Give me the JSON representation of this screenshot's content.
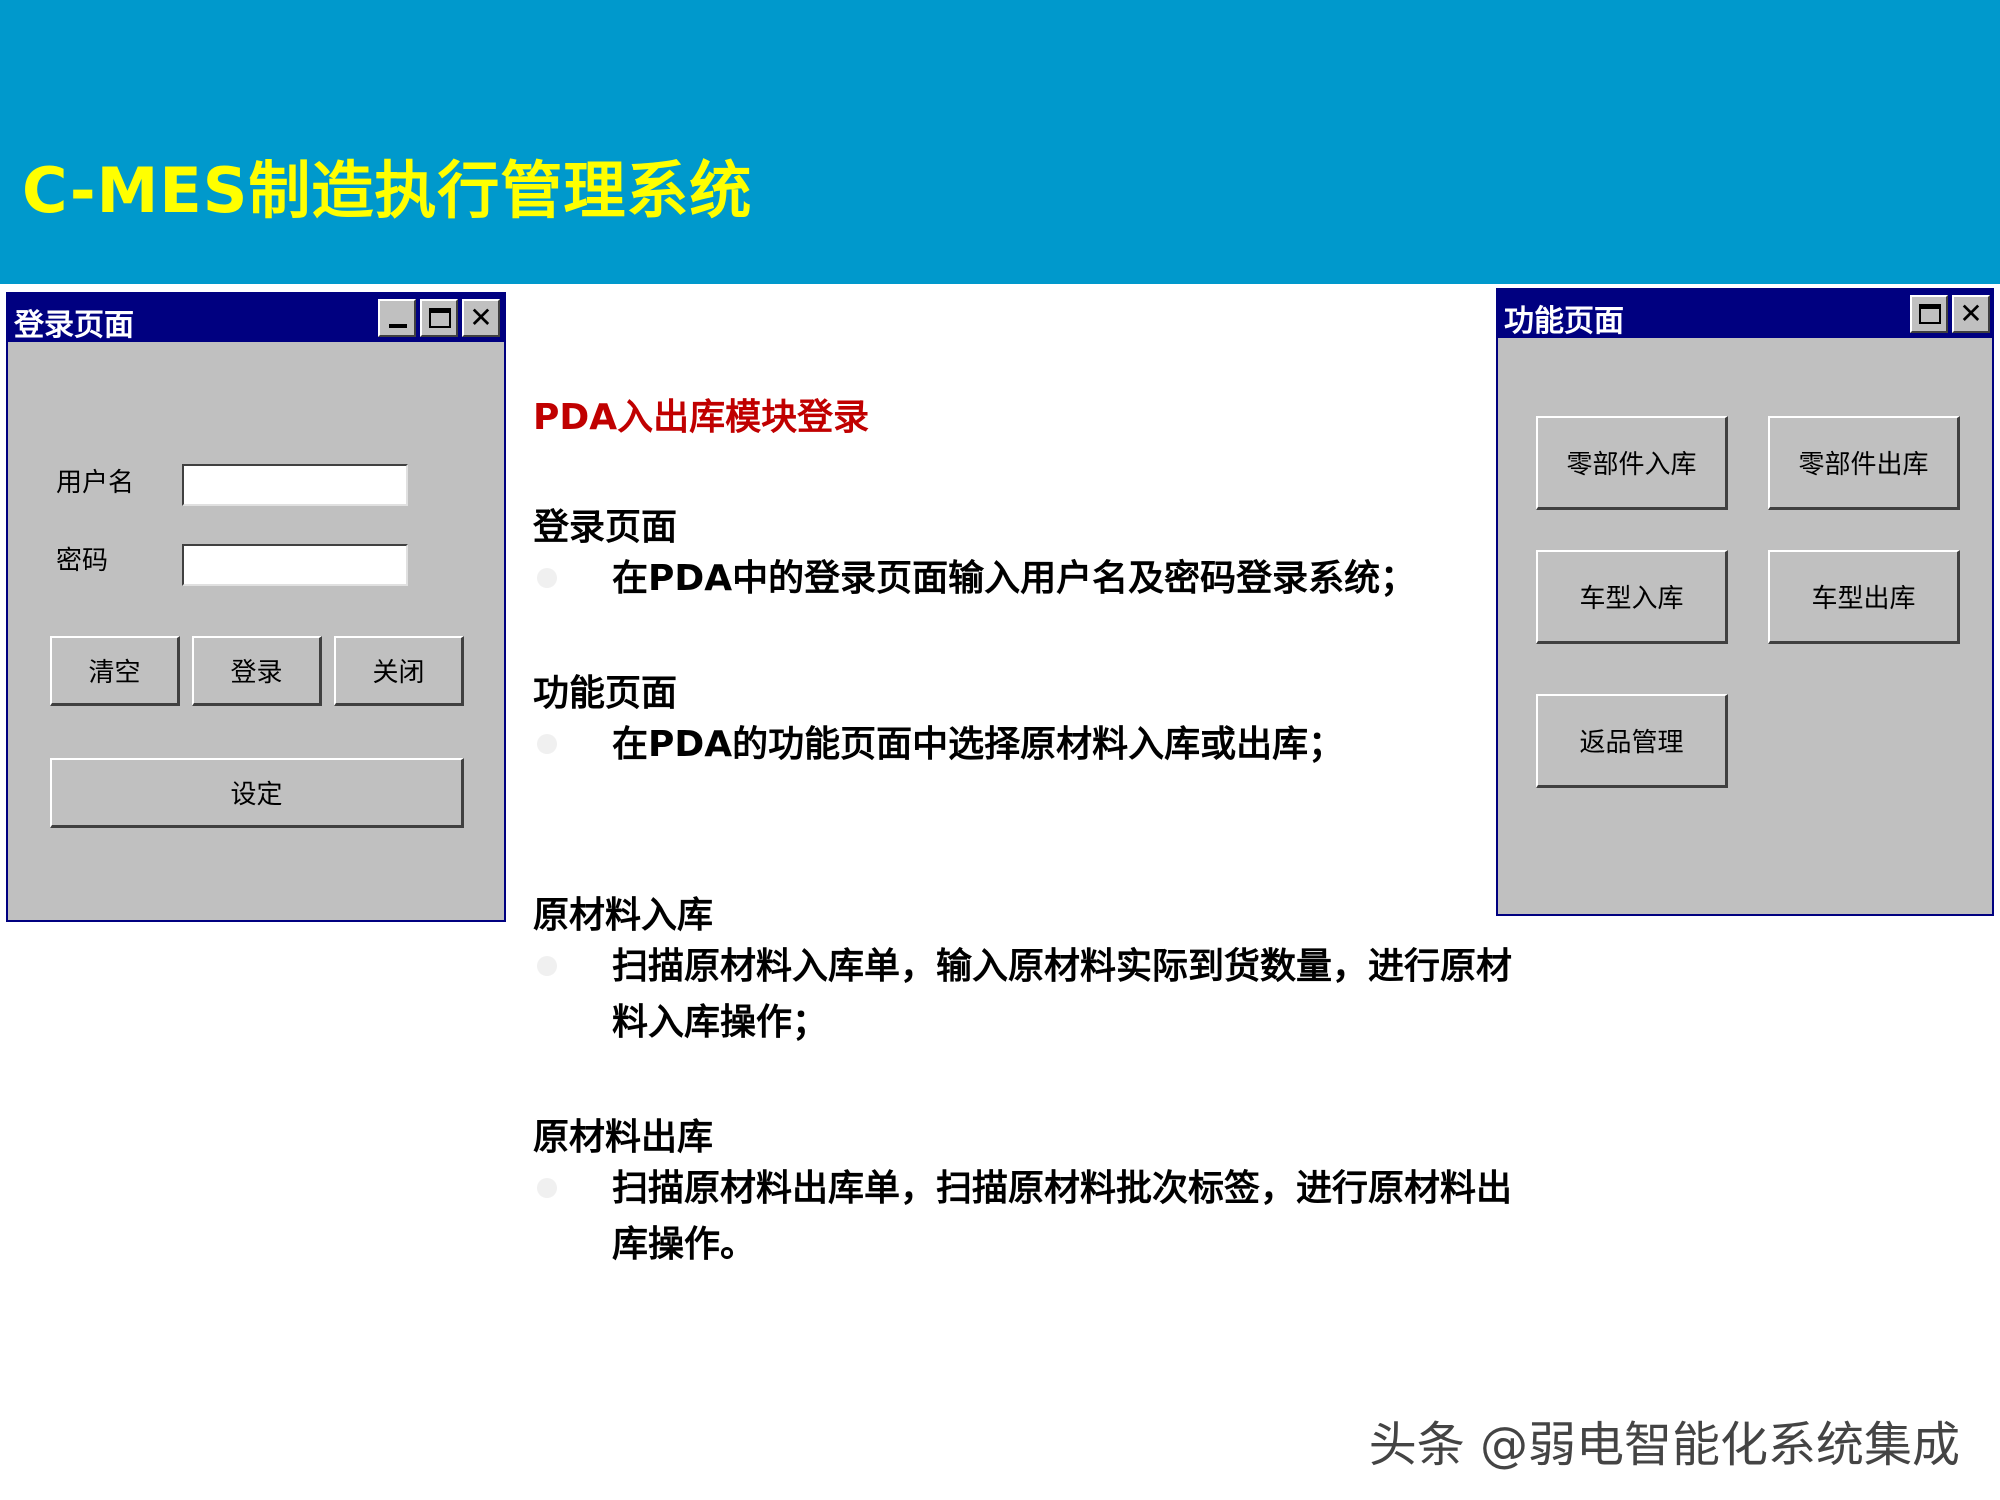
{
  "header": {
    "title": "C-MES制造执行管理系统",
    "bg": "#0099cc",
    "title_color": "#ffff00"
  },
  "login_window": {
    "title": "登录页面",
    "username_label": "用户名",
    "password_label": "密码",
    "username_value": "",
    "password_value": "",
    "buttons": {
      "clear": "清空",
      "login": "登录",
      "close": "关闭",
      "settings": "设定"
    },
    "icons": [
      "minimize-icon",
      "maximize-icon",
      "close-icon"
    ]
  },
  "function_window": {
    "title": "功能页面",
    "buttons": {
      "parts_in": "零部件入库",
      "parts_out": "零部件出库",
      "vehicle_in": "车型入库",
      "vehicle_out": "车型出库",
      "returns": "返品管理"
    },
    "icons": [
      "maximize-icon",
      "close-icon"
    ]
  },
  "content": {
    "module_title": "PDA入出库模块登录",
    "sections": [
      {
        "heading": "登录页面",
        "lines": [
          "在PDA中的登录页面输入用户名及密码登录系统；"
        ]
      },
      {
        "heading": "功能页面",
        "lines": [
          "在PDA的功能页面中选择原材料入库或出库；"
        ]
      },
      {
        "heading": "原材料入库",
        "lines": [
          "扫描原材料入库单，输入原材料实际到货数量，进行原材",
          "料入库操作；"
        ]
      },
      {
        "heading": "原材料出库",
        "lines": [
          "扫描原材料出库单，扫描原材料批次标签，进行原材料出",
          "库操作。"
        ]
      }
    ]
  },
  "watermark": "头条 @弱电智能化系统集成"
}
